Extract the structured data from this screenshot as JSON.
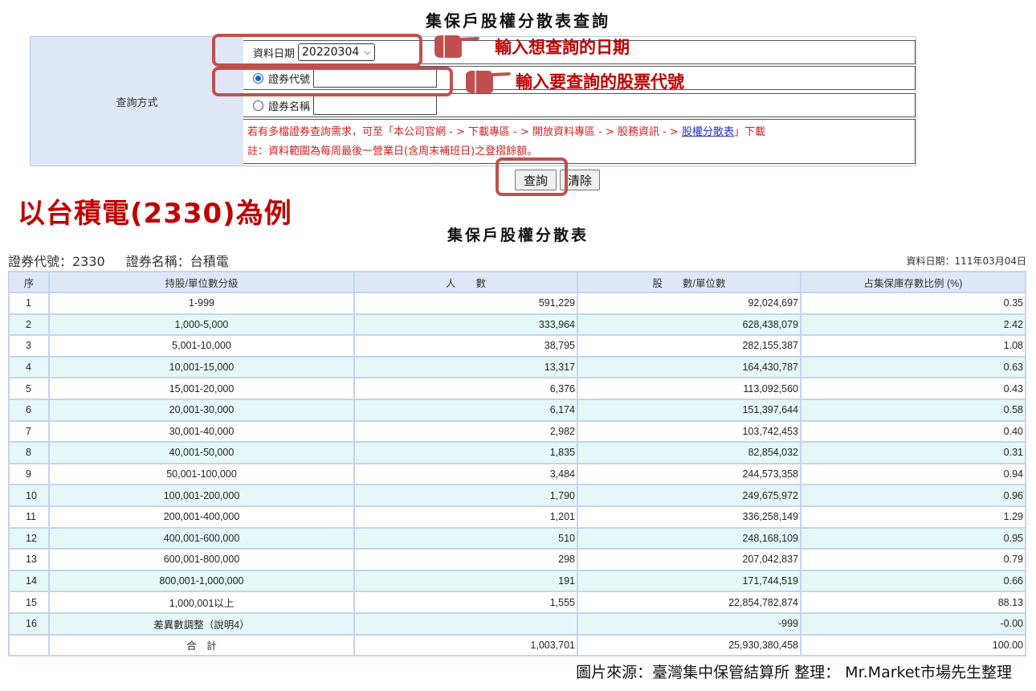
{
  "query": {
    "title": "集保戶股權分散表查詢",
    "method_label": "查詢方式",
    "date_label": "資料日期",
    "date_value": "20220304",
    "code_label": "證券代號",
    "name_label": "證券名稱",
    "note_line1_a": "若有多檔證券查詢需求，可至「本公司官網 - > 下載專區 - > 開放資料專區 - > 股務資訊 - > ",
    "note_link": "股權分散表",
    "note_line1_b": "」下載",
    "note_line2": "註：資料範圍為每周最後一營業日(含周末補班日)之登摺餘額。",
    "query_button": "查詢",
    "clear_button": "清除"
  },
  "annotations": {
    "date_hint": "輸入想查詢的日期",
    "code_hint": "輸入要查詢的股票代號",
    "example": "以台積電(2330)為例",
    "accent_color": "#c00000",
    "hand_icon": "pointing-hand-icon"
  },
  "result": {
    "title": "集保戶股權分散表",
    "stock_code": "證券代號：2330",
    "stock_name": "證券名稱：台積電",
    "data_date": "資料日期：111年03月04日",
    "headers": [
      "序",
      "持股/單位數分級",
      "人　　數",
      "股　　數/單位數",
      "占集保庫存數比例 (%)"
    ],
    "rows": [
      [
        "1",
        "1-999",
        "591,229",
        "92,024,697",
        "0.35"
      ],
      [
        "2",
        "1,000-5,000",
        "333,964",
        "628,438,079",
        "2.42"
      ],
      [
        "3",
        "5,001-10,000",
        "38,795",
        "282,155,387",
        "1.08"
      ],
      [
        "4",
        "10,001-15,000",
        "13,317",
        "164,430,787",
        "0.63"
      ],
      [
        "5",
        "15,001-20,000",
        "6,376",
        "113,092,560",
        "0.43"
      ],
      [
        "6",
        "20,001-30,000",
        "6,174",
        "151,397,644",
        "0.58"
      ],
      [
        "7",
        "30,001-40,000",
        "2,982",
        "103,742,453",
        "0.40"
      ],
      [
        "8",
        "40,001-50,000",
        "1,835",
        "82,854,032",
        "0.31"
      ],
      [
        "9",
        "50,001-100,000",
        "3,484",
        "244,573,358",
        "0.94"
      ],
      [
        "10",
        "100,001-200,000",
        "1,790",
        "249,675,972",
        "0.96"
      ],
      [
        "11",
        "200,001-400,000",
        "1,201",
        "336,258,149",
        "1.29"
      ],
      [
        "12",
        "400,001-600,000",
        "510",
        "248,168,109",
        "0.95"
      ],
      [
        "13",
        "600,001-800,000",
        "298",
        "207,042,837",
        "0.79"
      ],
      [
        "14",
        "800,001-1,000,000",
        "191",
        "171,744,519",
        "0.66"
      ],
      [
        "15",
        "1,000,001以上",
        "1,555",
        "22,854,782,874",
        "88.13"
      ],
      [
        "16",
        "差異數調整（說明4）",
        "",
        "-999",
        "-0.00"
      ],
      [
        "",
        "合　計",
        "1,003,701",
        "25,930,380,458",
        "100.00"
      ]
    ]
  },
  "source": "圖片來源：臺灣集中保管結算所  整理：  Mr.Market市場先生整理"
}
